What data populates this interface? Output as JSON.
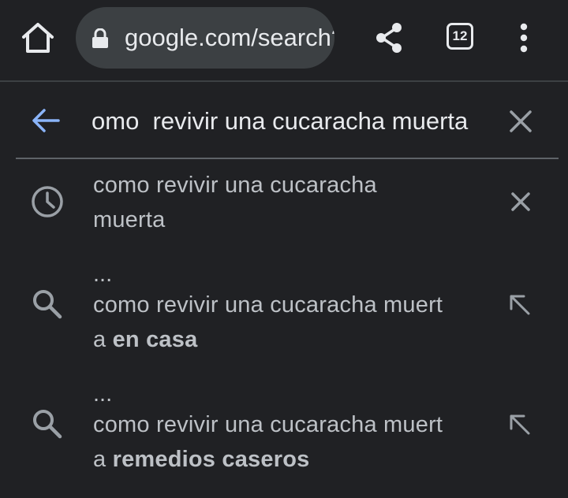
{
  "toolbar": {
    "url": "google.com/search?q=como+revivir+una+cucaracha+muerta",
    "tab_count": "12"
  },
  "search": {
    "query": "omo  revivir una cucaracha muerta"
  },
  "suggestions": [
    {
      "type": "history",
      "line1": "como revivir una cucaracha",
      "line2": "muerta"
    },
    {
      "type": "search",
      "ellipsis": "...",
      "line1": "como revivir una cucaracha muert",
      "line2_prefix": "a ",
      "line2_bold": "en casa"
    },
    {
      "type": "search",
      "ellipsis": "...",
      "line1": "como revivir una cucaracha muert",
      "line2_prefix": "a ",
      "line2_bold": "remedios caseros"
    }
  ],
  "colors": {
    "background": "#202124",
    "omnibox": "#3c4043",
    "accent": "#8ab4f8",
    "text": "#e8eaed",
    "secondary_text": "#bdc1c6",
    "icon": "#9aa0a6"
  },
  "icons": {
    "home": "home-icon",
    "lock": "lock-icon",
    "share": "share-icon",
    "tabs": "tab-switcher-icon",
    "menu": "more-vert-icon",
    "back": "arrow-back-icon",
    "clear": "close-icon",
    "history": "history-clock-icon",
    "search": "search-icon",
    "refine": "arrow-up-left-icon"
  }
}
